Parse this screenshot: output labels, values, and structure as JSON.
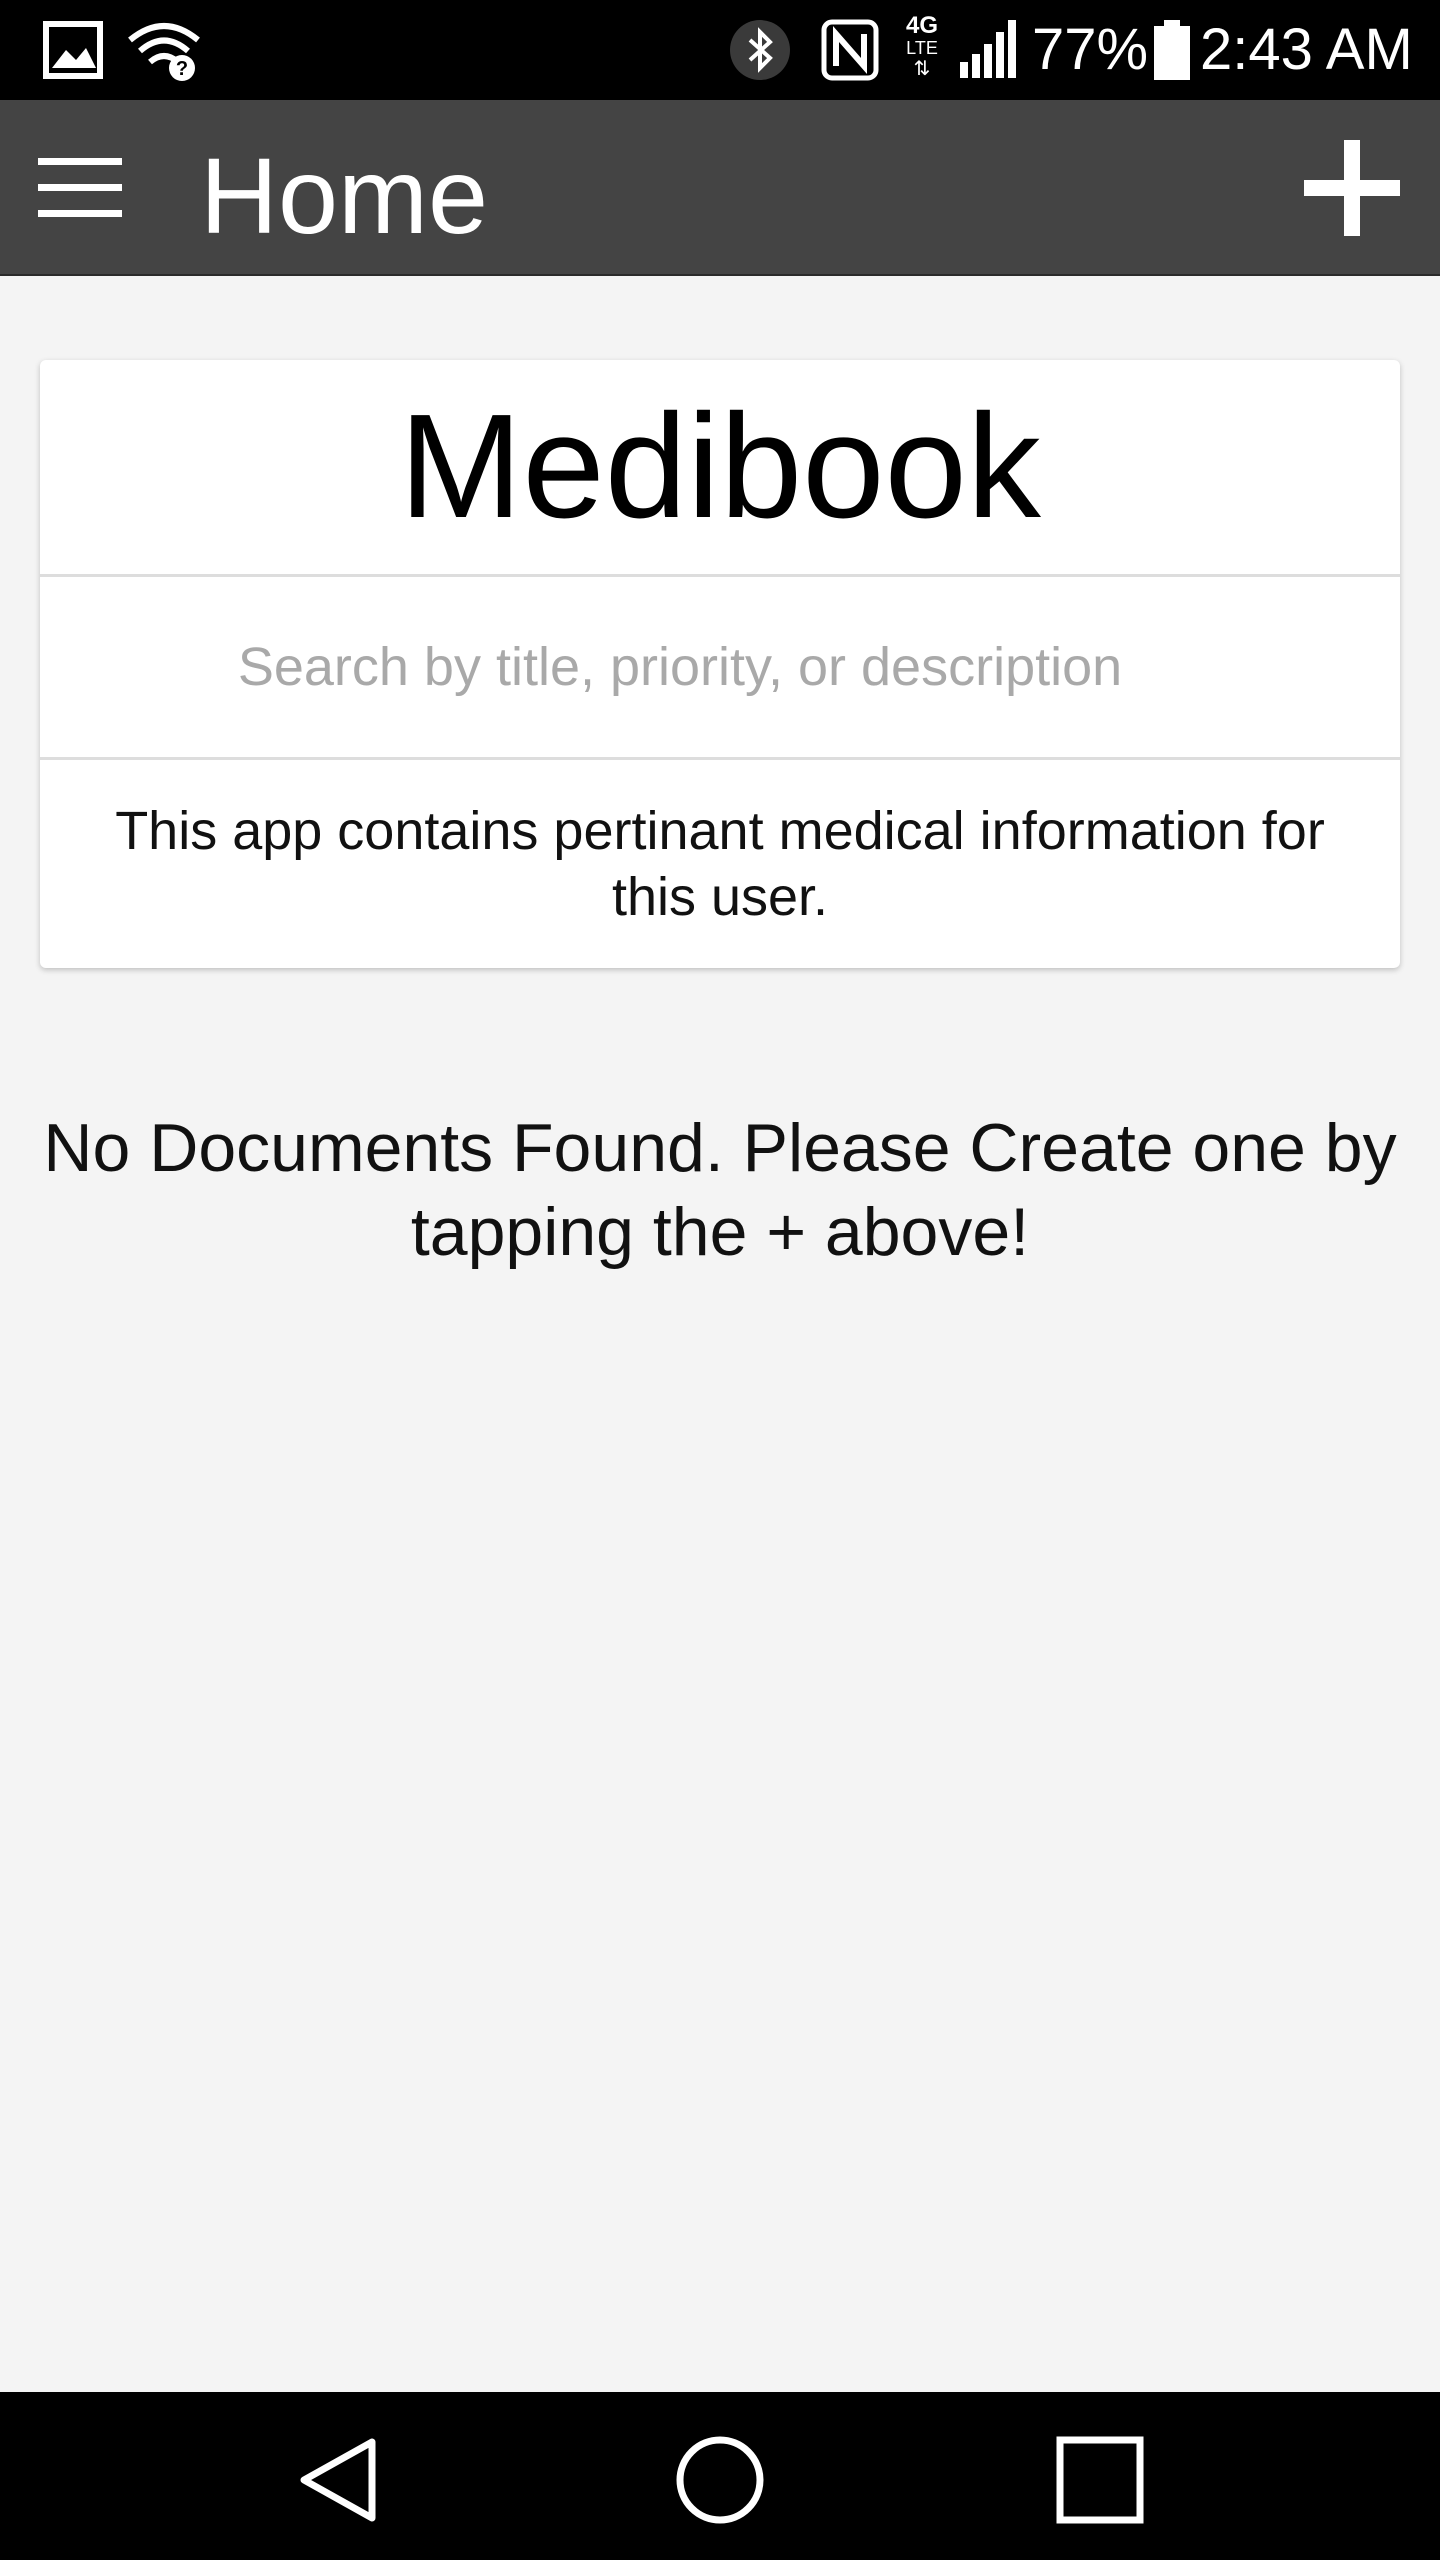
{
  "status_bar": {
    "battery_percent": "77%",
    "time": "2:43 AM",
    "network_label": "4G",
    "network_sublabel": "LTE",
    "icons": [
      "gallery-icon",
      "wifi-question-icon",
      "bluetooth-icon",
      "nfc-icon",
      "signal-icon",
      "battery-icon"
    ]
  },
  "app_bar": {
    "title": "Home",
    "menu_icon": "hamburger-menu-icon",
    "add_icon": "plus-icon"
  },
  "card": {
    "title": "Medibook",
    "search_placeholder": "Search by title, priority, or description",
    "search_value": "",
    "description": "This app contains pertinant medical information for this user."
  },
  "empty_state": {
    "message": "No Documents Found. Please Create one by tapping the + above!"
  },
  "nav_bar": {
    "icons": [
      "back-icon",
      "home-icon",
      "recents-icon"
    ]
  },
  "colors": {
    "status_bar_bg": "#000000",
    "app_bar_bg": "#444444",
    "page_bg": "#f4f4f4",
    "card_bg": "#ffffff",
    "placeholder": "#a9a9a9"
  }
}
